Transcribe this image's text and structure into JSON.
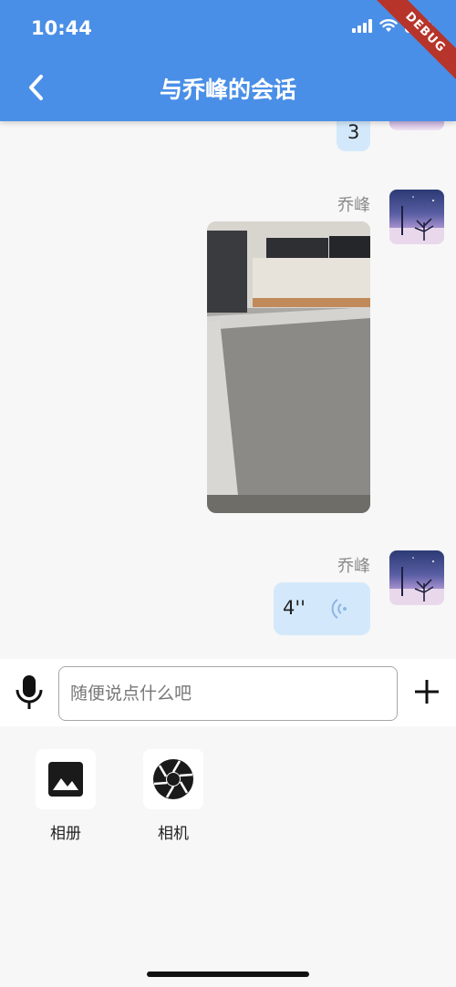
{
  "status_bar": {
    "time": "10:44"
  },
  "debug_banner": "DEBUG",
  "header": {
    "title": "与乔峰的会话",
    "back_icon": "chevron-left-icon"
  },
  "messages": [
    {
      "type": "text",
      "text": "3"
    },
    {
      "type": "image",
      "sender": "乔峰"
    },
    {
      "type": "voice",
      "sender": "乔峰",
      "duration": "4''"
    }
  ],
  "input": {
    "placeholder": "随便说点什么吧",
    "value": ""
  },
  "tools": [
    {
      "label": "相册",
      "icon": "photo-album-icon"
    },
    {
      "label": "相机",
      "icon": "camera-shutter-icon"
    }
  ],
  "colors": {
    "app_bar": "#4a8fe7",
    "bubble": "#d3e9fb",
    "ribbon": "#b7342a"
  }
}
